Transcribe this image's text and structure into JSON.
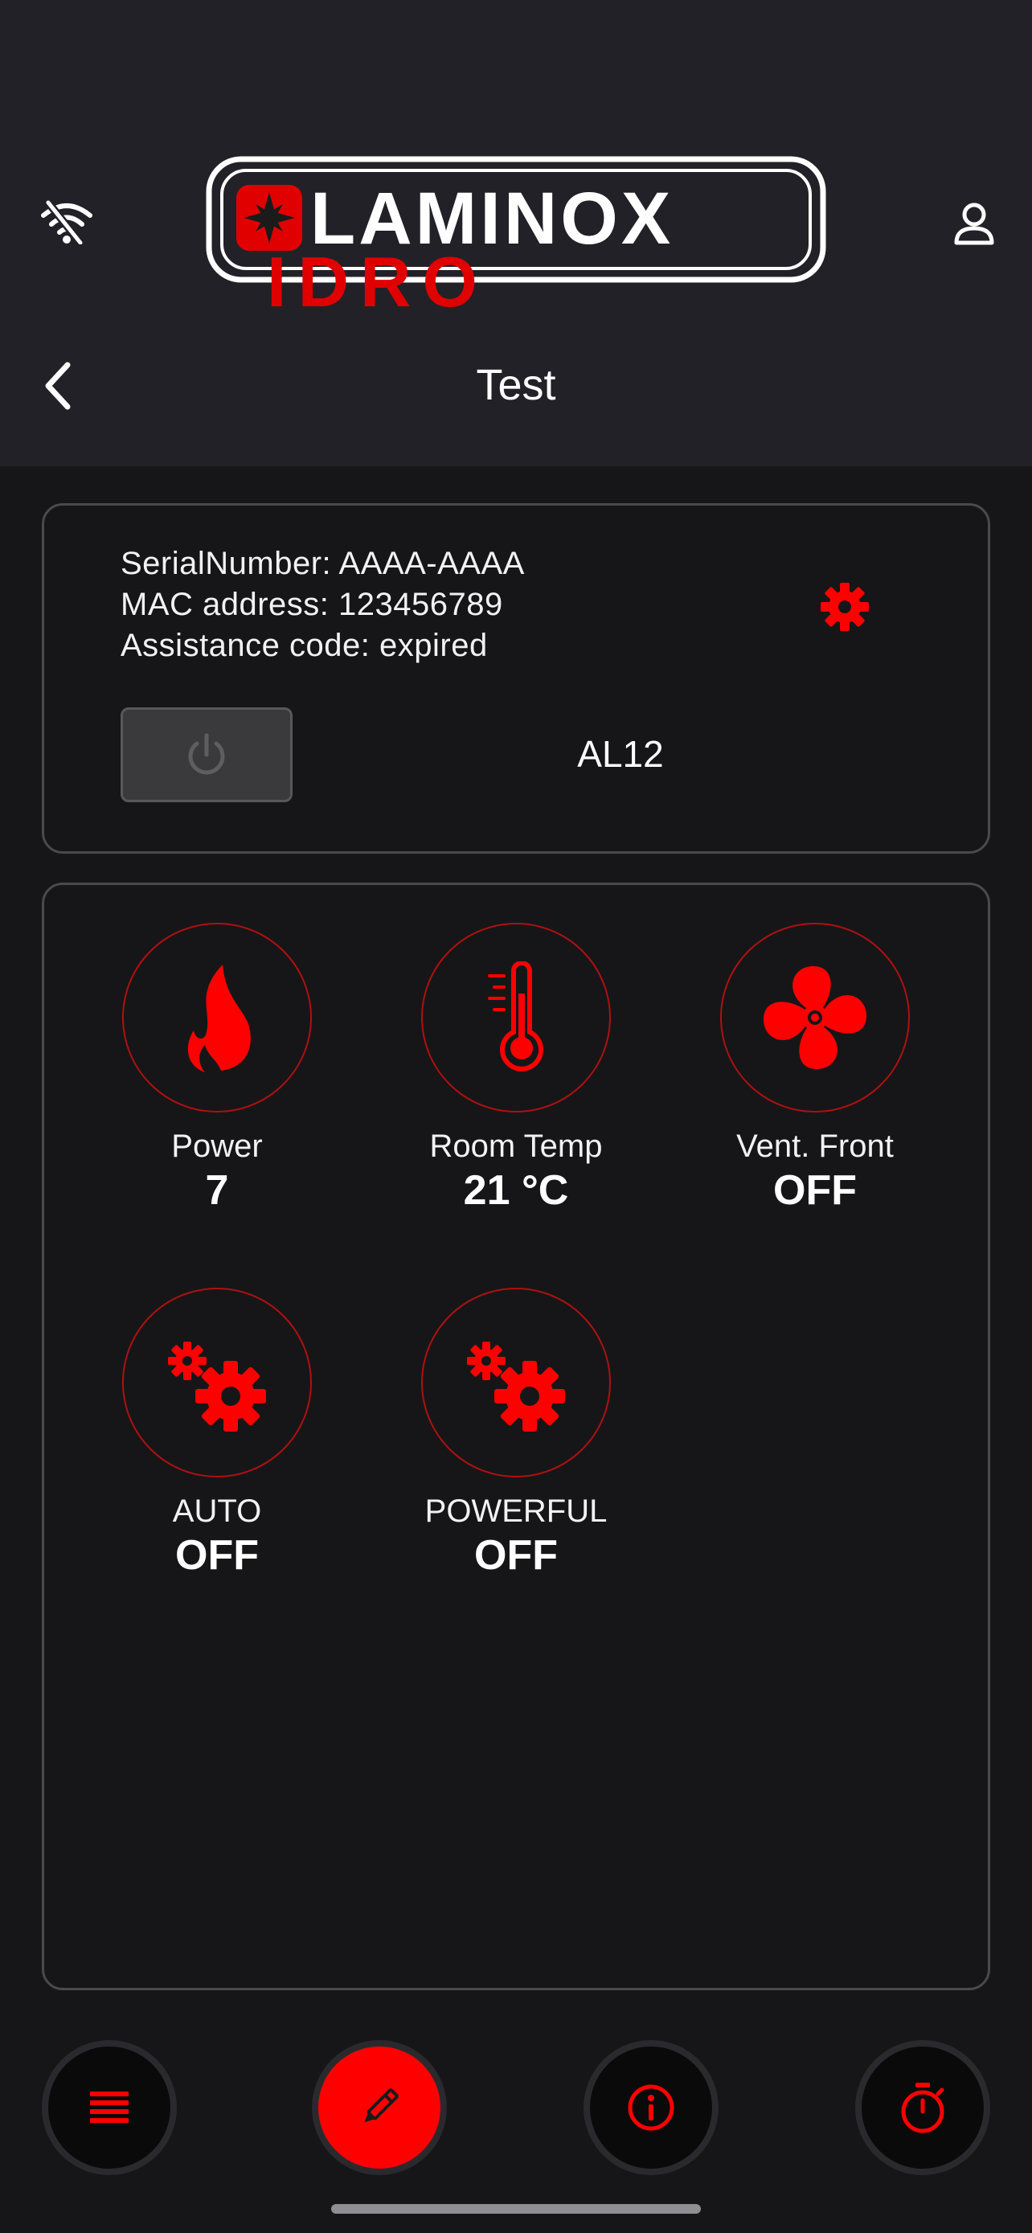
{
  "header": {
    "logo_top": "LAMINOX",
    "logo_bottom": "IDRO",
    "page_title": "Test"
  },
  "device": {
    "serial": "SerialNumber: AAAA-AAAA",
    "mac": "MAC address: 123456789",
    "assistance": "Assistance code: expired",
    "model": "AL12"
  },
  "tiles": [
    {
      "label": "Power",
      "value": "7",
      "icon": "flame-icon"
    },
    {
      "label": "Room Temp",
      "value": "21 °C",
      "icon": "thermometer-icon"
    },
    {
      "label": "Vent. Front",
      "value": "OFF",
      "icon": "fan-icon"
    },
    {
      "label": "AUTO",
      "value": "OFF",
      "icon": "gears-icon"
    },
    {
      "label": "POWERFUL",
      "value": "OFF",
      "icon": "gears-icon"
    }
  ],
  "nav": [
    {
      "icon": "menu-icon",
      "active": false
    },
    {
      "icon": "edit-icon",
      "active": true
    },
    {
      "icon": "info-icon",
      "active": false
    },
    {
      "icon": "timer-icon",
      "active": false
    }
  ],
  "colors": {
    "accent": "#ff0000",
    "header_bg": "#222127",
    "body_bg": "#161618"
  }
}
